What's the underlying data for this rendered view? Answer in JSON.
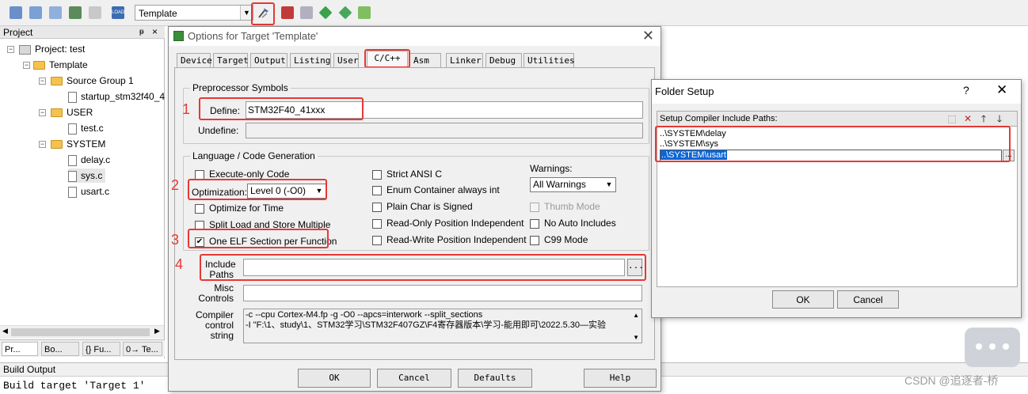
{
  "toolbar": {
    "target": "Template"
  },
  "project": {
    "header": "Project",
    "pin": "p",
    "close": "×",
    "tree": [
      {
        "label": "Project: test"
      },
      {
        "label": "Template"
      },
      {
        "label": "Source Group 1"
      },
      {
        "label": "startup_stm32f40_4"
      },
      {
        "label": "USER"
      },
      {
        "label": "test.c"
      },
      {
        "label": "SYSTEM"
      },
      {
        "label": "delay.c"
      },
      {
        "label": "sys.c"
      },
      {
        "label": "usart.c"
      }
    ],
    "tabs": [
      "Pr...",
      "Bo...",
      "{} Fu...",
      "0→ Te..."
    ]
  },
  "build_output": {
    "header": "Build Output",
    "text": "Build target 'Target 1'"
  },
  "options": {
    "title": "Options for Target 'Template'",
    "tabs": [
      "Device",
      "Target",
      "Output",
      "Listing",
      "User",
      "C/C++",
      "Asm",
      "Linker",
      "Debug",
      "Utilities"
    ],
    "preprocessor": {
      "title": "Preprocessor Symbols",
      "define_label": "Define:",
      "define_value": "STM32F40_41xxx",
      "undefine_label": "Undefine:",
      "undefine_value": ""
    },
    "lang": {
      "title": "Language / Code Generation",
      "execute_only": "Execute-only Code",
      "optimization_label": "Optimization:",
      "optimization_value": "Level 0 (-O0)",
      "optimize_time": "Optimize for Time",
      "split_load": "Split Load and Store Multiple",
      "one_elf": "One ELF Section per Function",
      "strict_ansi": "Strict ANSI C",
      "enum_container": "Enum Container always int",
      "plain_char": "Plain Char is Signed",
      "ro_pi": "Read-Only Position Independent",
      "rw_pi": "Read-Write Position Independent",
      "warnings_label": "Warnings:",
      "warnings_value": "All Warnings",
      "thumb_mode": "Thumb Mode",
      "no_auto": "No Auto Includes",
      "c99": "C99 Mode",
      "one_elf_checked": "✔"
    },
    "include_label_1": "Include",
    "include_label_2": "Paths",
    "include_value": "",
    "include_browse": "...",
    "misc_label_1": "Misc",
    "misc_label_2": "Controls",
    "misc_value": "",
    "compiler_label_1": "Compiler",
    "compiler_label_2": "control",
    "compiler_label_3": "string",
    "compiler_line_1": "-c --cpu Cortex-M4.fp -g -O0 --apcs=interwork --split_sections",
    "compiler_line_2": "-I \"F:\\1、study\\1、STM32学习\\STM32F407GZ\\F4寄存器版本\\学习-能用即可\\2022.5.30—实验",
    "buttons": {
      "ok": "OK",
      "cancel": "Cancel",
      "defaults": "Defaults",
      "help": "Help"
    },
    "annotations": [
      "1",
      "2",
      "3",
      "4"
    ]
  },
  "folder_setup": {
    "title": "Folder Setup",
    "help": "?",
    "close": "✕",
    "header": "Setup Compiler Include Paths:",
    "paths": [
      "..\\SYSTEM\\delay",
      "..\\SYSTEM\\sys",
      "..\\SYSTEM\\usart"
    ],
    "browse": "...",
    "ok": "OK",
    "cancel": "Cancel"
  },
  "watermark": "CSDN @追逐者-桥"
}
